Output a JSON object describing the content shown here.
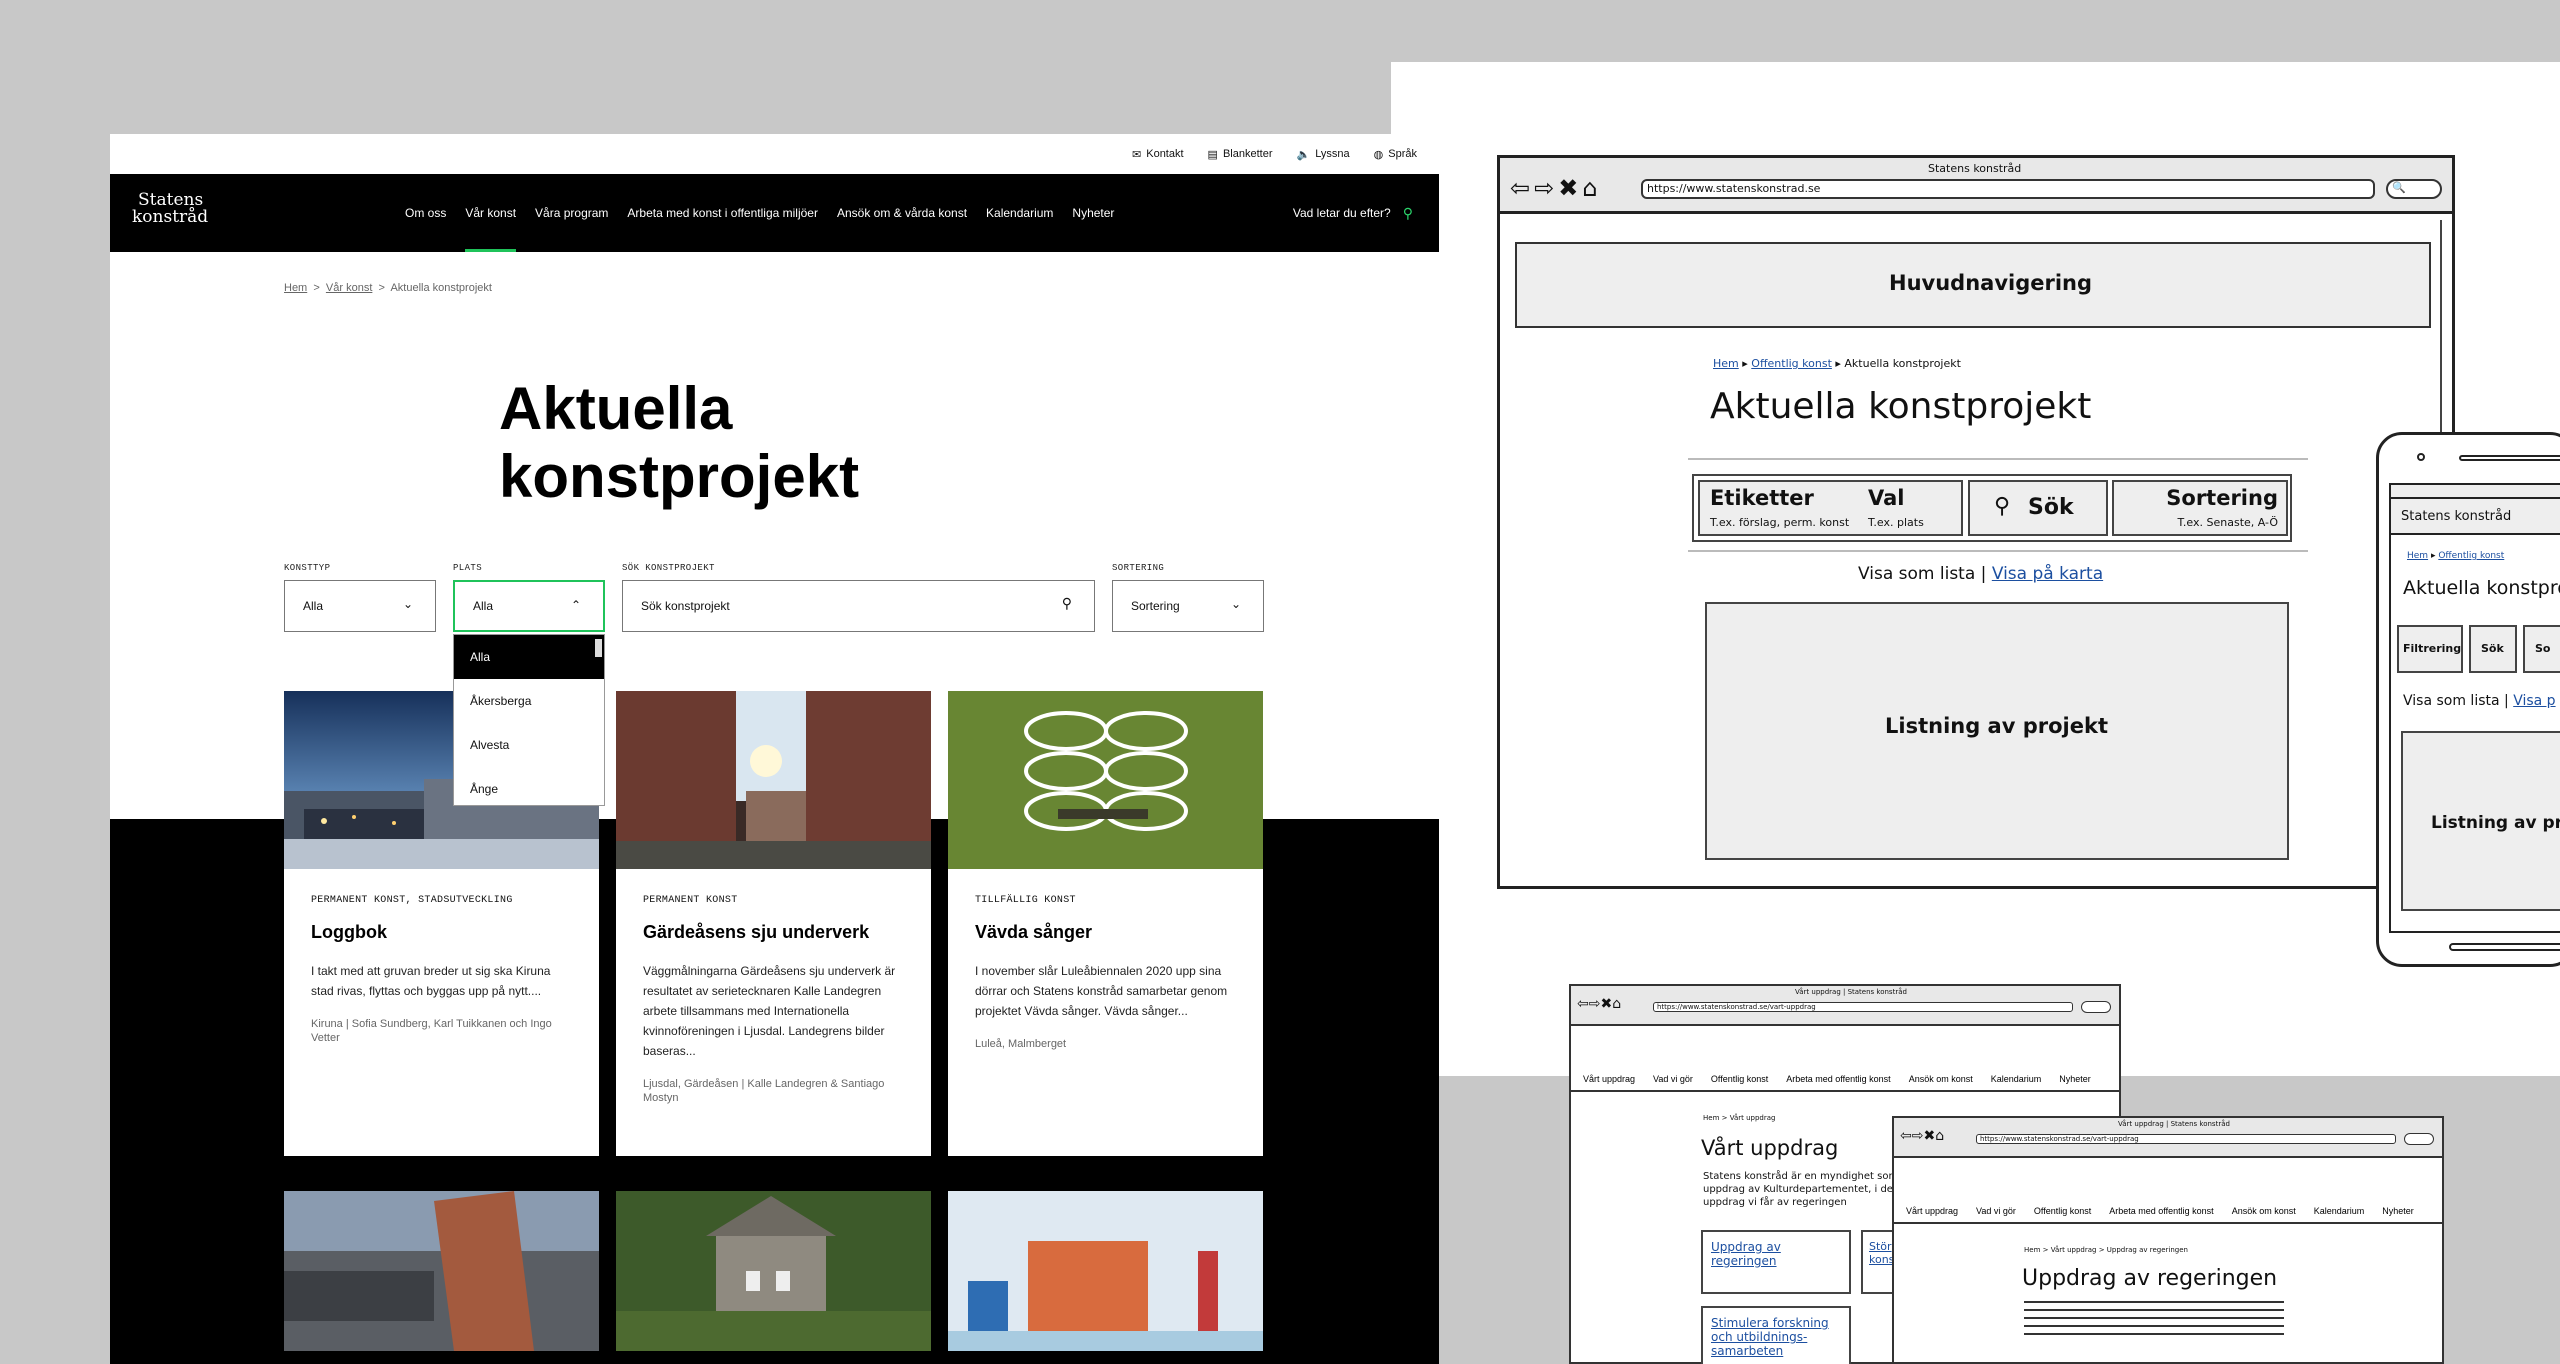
{
  "utility": {
    "contact": "Kontakt",
    "forms": "Blanketter",
    "listen": "Lyssna",
    "language": "Språk"
  },
  "logo": {
    "line1": "Statens",
    "line2": "konstråd"
  },
  "nav": [
    "Om oss",
    "Vår konst",
    "Våra program",
    "Arbeta med konst i offentliga miljöer",
    "Ansök om & vårda konst",
    "Kalendarium",
    "Nyheter"
  ],
  "nav_search": "Vad letar du efter?",
  "breadcrumb": {
    "home": "Hem",
    "parent": "Vår konst",
    "current": "Aktuella konstprojekt"
  },
  "page_title_l1": "Aktuella",
  "page_title_l2": "konstprojekt",
  "filters": {
    "konsttyp_label": "KONSTTYP",
    "konsttyp_value": "Alla",
    "plats_label": "PLATS",
    "plats_value": "Alla",
    "search_label": "SÖK KONSTPROJEKT",
    "search_value": "Sök konstprojekt",
    "sort_label": "SORTERING",
    "sort_value": "Sortering"
  },
  "plats_options": [
    "Alla",
    "Åkersberga",
    "Alvesta",
    "Ånge"
  ],
  "cards": [
    {
      "tag": "PERMANENT KONST, STADSUTVECKLING",
      "title": "Loggbok",
      "desc": "I takt med att gruvan breder ut sig ska Kiruna stad rivas, flyttas och byggas upp på nytt....",
      "meta": "Kiruna  |  Sofia Sundberg, Karl Tuikkanen och Ingo Vetter"
    },
    {
      "tag": "PERMANENT KONST",
      "title": "Gärdeåsens sju underverk",
      "desc": "Väggmålningarna Gärdeåsens sju underverk är resultatet av serietecknaren Kalle Landegren arbete tillsammans med Internationella kvinnoföreningen i Ljusdal. Landegrens bilder baseras...",
      "meta": "Ljusdal, Gärdeåsen  |  Kalle Landegren & Santiago Mostyn"
    },
    {
      "tag": "TILLFÄLLIG KONST",
      "title": "Vävda sånger",
      "desc": "I november slår Luleåbiennalen 2020 upp sina dörrar och Statens konstråd samarbetar genom projektet Vävda sånger. Vävda sånger...",
      "meta": "Luleå, Malmberget"
    }
  ],
  "wire_desktop": {
    "window_title": "Statens konstråd",
    "url": "https://www.statenskonstrad.se",
    "nav": "Huvudnavigering",
    "crumb_home": "Hem",
    "crumb_parent": "Offentlig konst",
    "crumb_current": "Aktuella konstprojekt",
    "title": "Aktuella konstprojekt",
    "btn1_title": "Etiketter",
    "btn1_sub": "T.ex. förslag, perm. konst",
    "btn2_title": "Val",
    "btn2_sub": "T.ex. plats",
    "btn3": "Sök",
    "btn4_title": "Sortering",
    "btn4_sub": "T.ex. Senaste, A-Ö",
    "view_list": "Visa som lista",
    "view_map": "Visa på karta",
    "listing": "Listning av projekt"
  },
  "wire_mobile": {
    "title": "Statens konstråd",
    "crumb_home": "Hem",
    "crumb_parent": "Offentlig konst",
    "heading": "Aktuella konstprojekt",
    "btn1": "Filtrering",
    "btn2": "Sök",
    "btn3": "So",
    "view_list": "Visa som lista",
    "view_map": "Visa p",
    "listing": "Listning av proje"
  },
  "wire_small1": {
    "window_title": "Vårt uppdrag | Statens konstråd",
    "url": "https://www.statenskonstrad.se/vart-uppdrag",
    "nav": [
      "Vårt uppdrag",
      "Vad vi gör",
      "Offentlig konst",
      "Arbeta med offentlig konst",
      "Ansök om konst",
      "Kalendarium",
      "Nyheter"
    ],
    "crumb": "Hem > Vårt uppdrag",
    "heading": "Vårt uppdrag",
    "intro": "Statens konstråd är en myndighet som uppdrag av Kulturdepartementet, i dett de uppdrag vi får av regeringen",
    "box1": "Uppdrag av regeringen",
    "box2": "Stör kons",
    "box3": "Stimulera forskning och utbildnings-samarbeten"
  },
  "wire_small2": {
    "window_title": "Vårt uppdrag | Statens konstråd",
    "url": "https://www.statenskonstrad.se/vart-uppdrag",
    "nav": [
      "Vårt uppdrag",
      "Vad vi gör",
      "Offentlig konst",
      "Arbeta med offentlig konst",
      "Ansök om konst",
      "Kalendarium",
      "Nyheter"
    ],
    "crumb": "Hem > Vårt uppdrag > Uppdrag av regeringen",
    "heading": "Uppdrag av regeringen"
  }
}
